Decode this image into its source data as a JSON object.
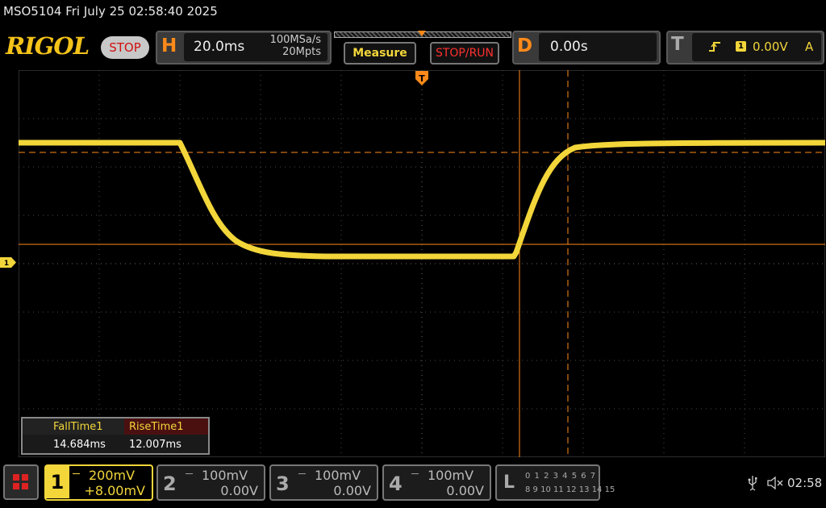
{
  "title_bar": {
    "text": "MSO5104  Fri July 25 02:58:40 2025"
  },
  "brand": {
    "logo": "RIGOL",
    "run_state": "STOP"
  },
  "horizontal": {
    "letter": "H",
    "time_scale": "20.0ms",
    "sample_rate": "100MSa/s",
    "memory_depth": "20Mpts"
  },
  "buttons": {
    "measure": "Measure",
    "stop_run": "STOP/RUN"
  },
  "delay": {
    "letter": "D",
    "value": "0.00s"
  },
  "trigger": {
    "letter": "T",
    "slope_icon": "rising-edge-icon",
    "source": "1",
    "level": "0.00V",
    "mode": "A"
  },
  "measurements": {
    "fall_label": "FallTime1",
    "fall_value": "14.684ms",
    "rise_label": "RiseTime1",
    "rise_value": "12.007ms"
  },
  "channels": [
    {
      "num": "1",
      "coupling_icon": "dc-coupling-icon",
      "scale": "200mV",
      "offset": "+8.00mV",
      "active": true,
      "color": "#f2d63a"
    },
    {
      "num": "2",
      "coupling_icon": "dc-coupling-icon",
      "scale": "100mV",
      "offset": "0.00V",
      "active": false
    },
    {
      "num": "3",
      "coupling_icon": "dc-coupling-icon",
      "scale": "100mV",
      "offset": "0.00V",
      "active": false
    },
    {
      "num": "4",
      "coupling_icon": "dc-coupling-icon",
      "scale": "100mV",
      "offset": "0.00V",
      "active": false
    }
  ],
  "logic_analyzer": {
    "letter": "L",
    "row1": "0 1 2 3   4 5 6 7",
    "row2": "8 9 10 11 12 13 14 15"
  },
  "ch1_marker_label": "1",
  "status": {
    "time": "02:58"
  },
  "colors": {
    "trace": "#f2d63a",
    "cursor": "#ff8a1a",
    "background": "#000000"
  }
}
